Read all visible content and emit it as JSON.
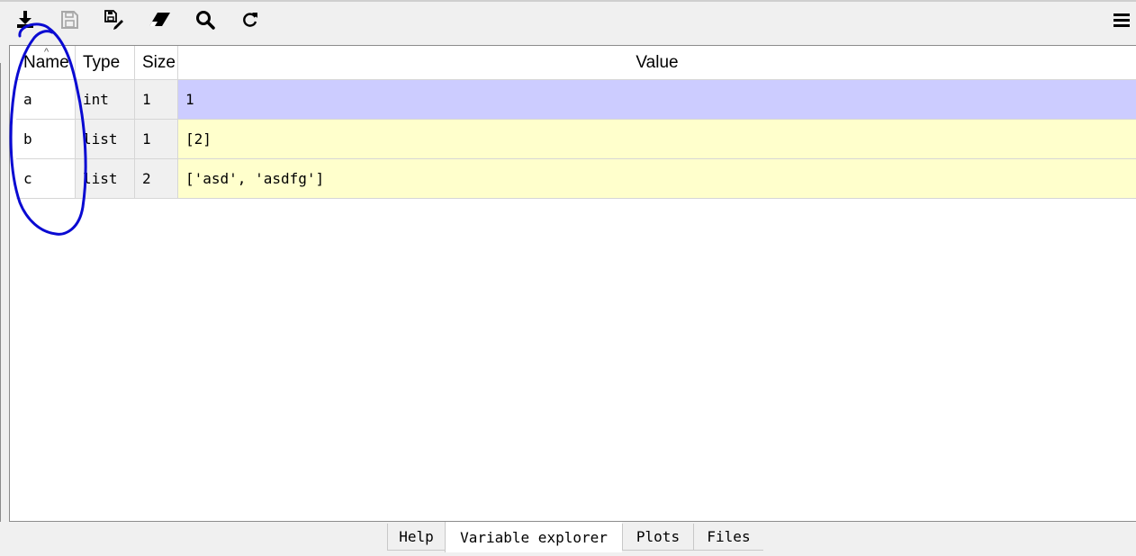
{
  "toolbar": {
    "icons": [
      "import-data-icon",
      "save-data-icon",
      "save-as-icon",
      "erase-icon",
      "search-icon",
      "refresh-icon",
      "menu-icon"
    ]
  },
  "table": {
    "columns": [
      "Name",
      "Type",
      "Size",
      "Value"
    ],
    "sort_indicator": "^",
    "rows": [
      {
        "name": "a",
        "type": "int",
        "size": "1",
        "value": "1",
        "color": "#ccccff"
      },
      {
        "name": "b",
        "type": "list",
        "size": "1",
        "value": "[2]",
        "color": "#ffffcc"
      },
      {
        "name": "c",
        "type": "list",
        "size": "2",
        "value": "['asd', 'asdfg']",
        "color": "#ffffcc"
      }
    ]
  },
  "tabs": [
    {
      "label": "Help",
      "active": false
    },
    {
      "label": "Variable explorer",
      "active": true
    },
    {
      "label": "Plots",
      "active": false
    },
    {
      "label": "Files",
      "active": false
    }
  ],
  "colors": {
    "annotation_ink": "#0a0ad2",
    "selected_row": "#ccccff",
    "row_fill": "#ffffcc"
  }
}
